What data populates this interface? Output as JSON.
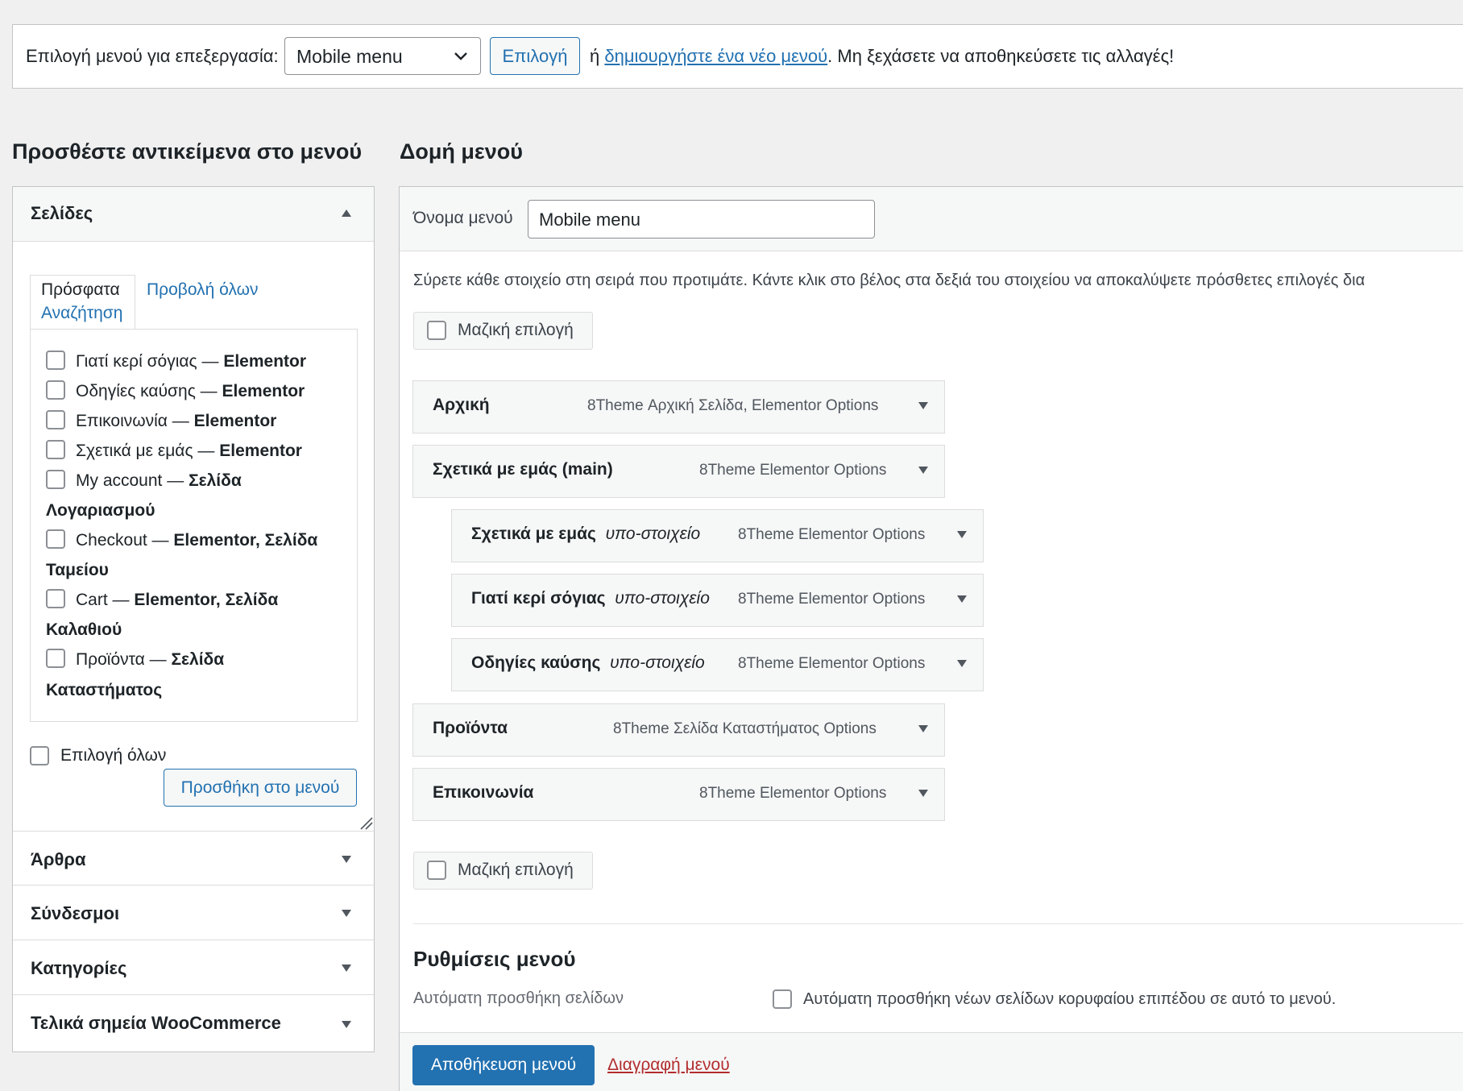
{
  "topbar": {
    "label": "Επιλογή μενού για επεξεργασία:",
    "selected_menu": "Mobile menu",
    "select_button": "Επιλογή",
    "or_text": "ή",
    "create_link": "δημιουργήστε ένα νέο μενού",
    "reminder": ". Μη ξεχάσετε να αποθηκεύσετε τις αλλαγές!"
  },
  "left": {
    "title": "Προσθέστε αντικείμενα στο μενού",
    "pages_section": "Σελίδες",
    "tabs": [
      "Πρόσφατα",
      "Προβολή όλων",
      "Αναζήτηση"
    ],
    "pages": [
      {
        "name": "Γιατί κερί σόγιας —",
        "type": "Elementor"
      },
      {
        "name": "Οδηγίες καύσης —",
        "type": "Elementor"
      },
      {
        "name": "Επικοινωνία —",
        "type": "Elementor"
      },
      {
        "name": "Σχετικά με εμάς —",
        "type": "Elementor"
      },
      {
        "name": "My account —",
        "type": "Σελίδα",
        "type2": "Λογαριασμού"
      },
      {
        "name": "Checkout —",
        "type": "Elementor, Σελίδα",
        "type2": "Ταμείου"
      },
      {
        "name": "Cart —",
        "type": "Elementor, Σελίδα",
        "type2": "Καλαθιού"
      },
      {
        "name": "Προϊόντα —",
        "type": "Σελίδα",
        "type2": "Καταστήματος"
      }
    ],
    "select_all": "Επιλογή όλων",
    "add_button": "Προσθήκη στο μενού",
    "sections": [
      "Άρθρα",
      "Σύνδεσμοι",
      "Κατηγορίες",
      "Τελικά σημεία WooCommerce"
    ]
  },
  "right": {
    "title": "Δομή μενού",
    "name_label": "Όνομα μενού",
    "name_value": "Mobile menu",
    "instructions": "Σύρετε κάθε στοιχείο στη σειρά που προτιμάτε. Κάντε κλικ στο βέλος στα δεξιά του στοιχείου να αποκαλύψετε πρόσθετες επιλογές δια",
    "bulk_select": "Μαζική επιλογή",
    "items": [
      {
        "title": "Αρχική",
        "sub": "",
        "options": "8Theme Αρχική Σελίδα, Elementor Options"
      },
      {
        "title": "Σχετικά με εμάς (main)",
        "sub": "",
        "options": "8Theme Elementor Options"
      },
      {
        "title": "Σχετικά με εμάς",
        "sub": "υπο-στοιχείο",
        "options": "8Theme Elementor Options"
      },
      {
        "title": "Γιατί κερί σόγιας",
        "sub": "υπο-στοιχείο",
        "options": "8Theme Elementor Options"
      },
      {
        "title": "Οδηγίες καύσης",
        "sub": "υπο-στοιχείο",
        "options": "8Theme Elementor Options"
      },
      {
        "title": "Προϊόντα",
        "sub": "",
        "options": "8Theme Σελίδα Καταστήματος Options"
      },
      {
        "title": "Επικοινωνία",
        "sub": "",
        "options": "8Theme Elementor Options"
      }
    ],
    "settings_title": "Ρυθμίσεις μενού",
    "auto_add_label": "Αυτόματη προσθήκη σελίδων",
    "auto_add_text": "Αυτόματη προσθήκη νέων σελίδων κορυφαίου επιπέδου σε αυτό το μενού.",
    "save_button": "Αποθήκευση μενού",
    "delete_link": "Διαγραφή μενού"
  }
}
